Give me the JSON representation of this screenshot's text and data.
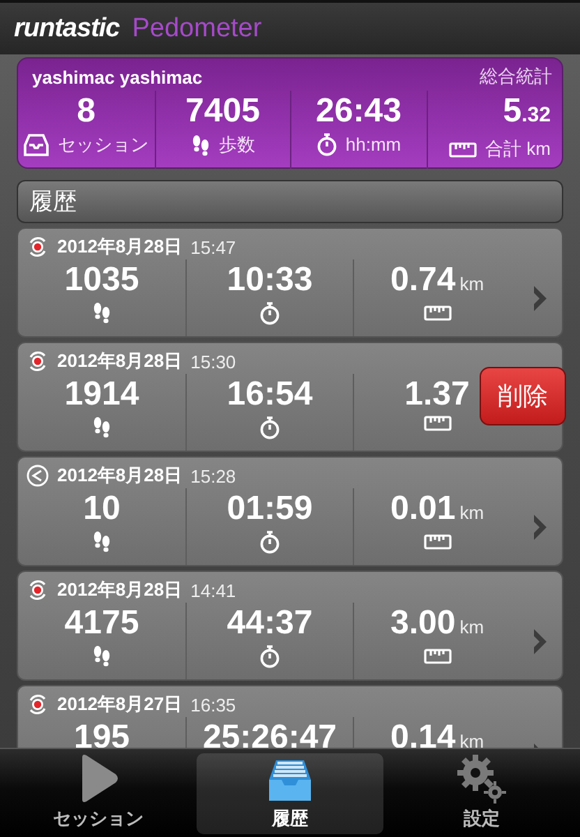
{
  "header": {
    "brand": "runtastic",
    "app": "Pedometer"
  },
  "summary": {
    "user": "yashimac yashimac",
    "title": "総合統計",
    "stats": [
      {
        "kind": "sessions",
        "value": "8",
        "label": "セッション"
      },
      {
        "kind": "steps",
        "value": "7405",
        "label": "歩数"
      },
      {
        "kind": "time",
        "value": "26:43",
        "label": "hh:mm"
      },
      {
        "kind": "distance",
        "value": "5.32",
        "label": "合計 km"
      }
    ]
  },
  "history": {
    "title": "履歴",
    "rows": [
      {
        "kind": "record",
        "date": "2012年8月28日",
        "time": "15:47",
        "steps": "1035",
        "duration": "10:33",
        "distance": "0.74",
        "unit": "km"
      },
      {
        "kind": "record",
        "date": "2012年8月28日",
        "time": "15:30",
        "steps": "1914",
        "duration": "16:54",
        "distance": "1.37",
        "delete_button": "削除"
      },
      {
        "kind": "share",
        "date": "2012年8月28日",
        "time": "15:28",
        "steps": "10",
        "duration": "01:59",
        "distance": "0.01",
        "unit": "km"
      },
      {
        "kind": "record",
        "date": "2012年8月28日",
        "time": "14:41",
        "steps": "4175",
        "duration": "44:37",
        "distance": "3.00",
        "unit": "km"
      },
      {
        "kind": "record",
        "date": "2012年8月27日",
        "time": "16:35",
        "steps": "195",
        "duration": "25:26:47",
        "distance": "0.14",
        "unit": "km"
      }
    ]
  },
  "tabs": [
    {
      "kind": "play",
      "label": "セッション",
      "selected": false
    },
    {
      "kind": "tray",
      "label": "履歴",
      "selected": true
    },
    {
      "kind": "gears",
      "label": "設定",
      "selected": false
    }
  ]
}
